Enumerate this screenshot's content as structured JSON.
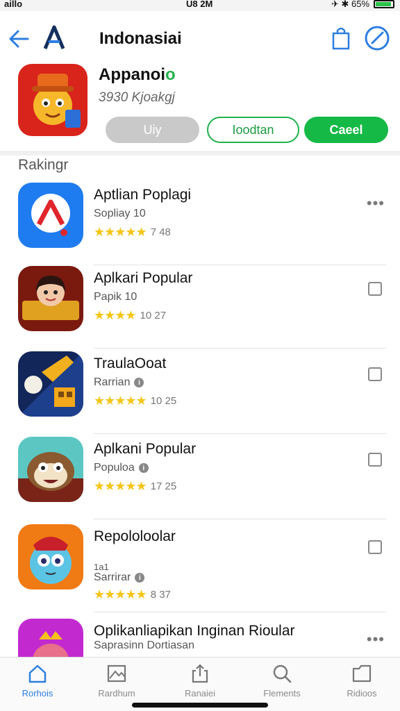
{
  "status": {
    "left": "aillo",
    "time": "U8 2M",
    "right": "✈ ✱ 65%"
  },
  "nav": {
    "title": "Indonasiai",
    "back_icon": "back-arrow-icon",
    "logo_icon": "appstore-logo-icon",
    "bag_icon": "shopping-bag-icon",
    "compass_icon": "compass-icon",
    "accent": "#2d7ee0"
  },
  "featured": {
    "title_main": "Appanoi",
    "title_accent": "o",
    "subtitle": "3930 Kjoakgj",
    "buttons": {
      "gray": "Uiy",
      "outline": "Ioodtan",
      "green": "Caeel"
    }
  },
  "section": {
    "label": "Rakingr"
  },
  "apps": [
    {
      "name": "Aptlian Poplagi",
      "sub": "Sopliay 10",
      "extra": "",
      "info": false,
      "stars": "★★★★★",
      "rating": "7 48",
      "action": "more"
    },
    {
      "name": "Aplkari Popular",
      "sub": "Papik 10",
      "extra": "",
      "info": false,
      "stars": "★★★★",
      "rating": "10 27",
      "action": "checkbox"
    },
    {
      "name": "TraulaOoat",
      "sub": "Rarrian",
      "extra": "",
      "info": true,
      "stars": "★★★★★",
      "rating": "10 25",
      "action": "checkbox"
    },
    {
      "name": "Aplkani Popular",
      "sub": "Populoa",
      "extra": "",
      "info": true,
      "stars": "★★★★★",
      "rating": "17 25",
      "action": "checkbox"
    },
    {
      "name": "Repololoolar",
      "sub": "Sarrirar",
      "extra": "1a1",
      "info": true,
      "stars": "★★★★★",
      "rating": "8 37",
      "action": "checkbox"
    },
    {
      "name": "Oplikanliapikan Inginan Rioular",
      "sub": "Saprasinn Dortiasan",
      "extra": "",
      "info": false,
      "stars": "",
      "rating": "",
      "action": "more"
    }
  ],
  "tabs": [
    {
      "label": "Rorhois",
      "icon": "home-icon",
      "active": true
    },
    {
      "label": "Rardhum",
      "icon": "photo-icon",
      "active": false
    },
    {
      "label": "Ranaiei",
      "icon": "share-icon",
      "active": false
    },
    {
      "label": "Flements",
      "icon": "search-icon",
      "active": false
    },
    {
      "label": "Ridioos",
      "icon": "folder-icon",
      "active": false
    }
  ]
}
